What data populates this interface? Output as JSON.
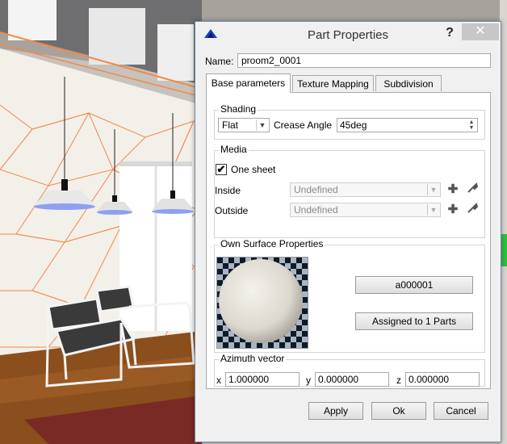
{
  "window": {
    "title": "Part Properties",
    "help": "?",
    "close": "✕"
  },
  "name": {
    "label": "Name:",
    "value": "proom2_0001"
  },
  "tabs": [
    {
      "label": "Base parameters"
    },
    {
      "label": "Texture Mapping"
    },
    {
      "label": "Subdivision"
    }
  ],
  "shading": {
    "title": "Shading",
    "mode": "Flat",
    "crease_label": "Crease Angle",
    "crease_value": "45deg"
  },
  "media": {
    "title": "Media",
    "one_sheet_label": "One sheet",
    "one_sheet_checked": true,
    "inside_label": "Inside",
    "inside_value": "Undefined",
    "outside_label": "Outside",
    "outside_value": "Undefined"
  },
  "surface": {
    "title": "Own Surface Properties",
    "material_button": "a000001",
    "assigned_button": "Assigned to 1 Parts"
  },
  "azimuth": {
    "title": "Azimuth vector",
    "x_label": "x",
    "x": "1.000000",
    "y_label": "y",
    "y": "0.000000",
    "z_label": "z",
    "z": "0.000000"
  },
  "buttons": {
    "apply": "Apply",
    "ok": "Ok",
    "cancel": "Cancel"
  },
  "colors": {
    "wireframe": "#f08a4a",
    "floor": "#8a4f1c",
    "lamp_glow": "#8ea0f0",
    "dialog_bg": "#f0f0f0"
  }
}
